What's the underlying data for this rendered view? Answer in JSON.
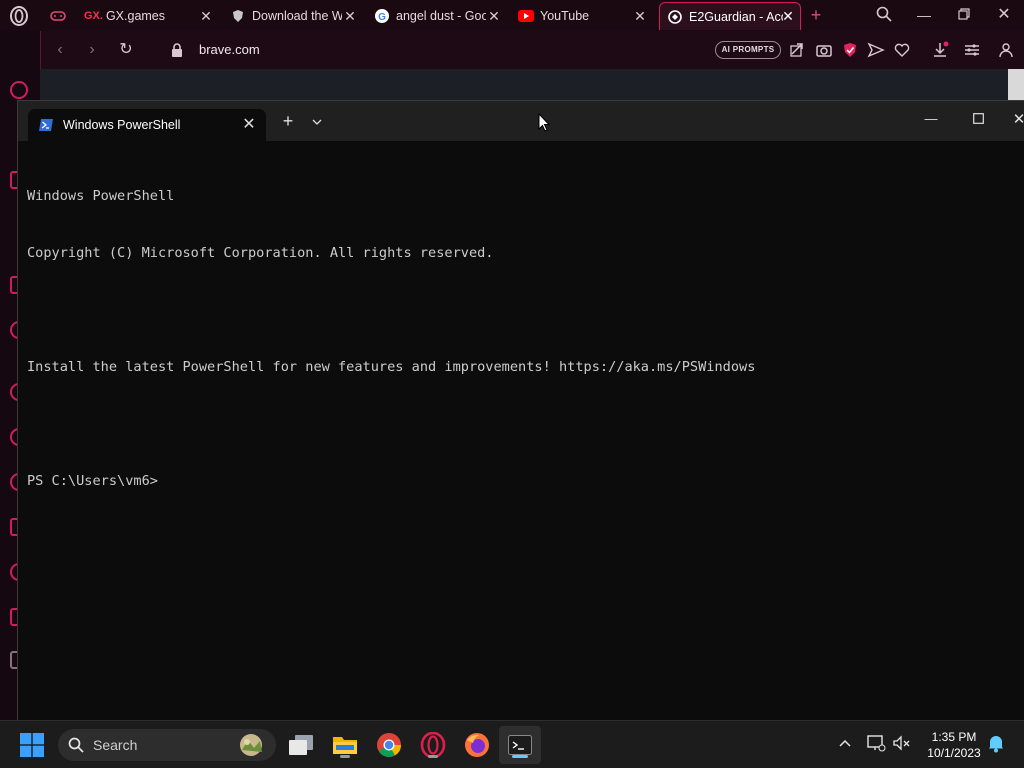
{
  "browser": {
    "tabs": [
      {
        "label": "",
        "icon": "gamepad-icon"
      },
      {
        "label": "GX.games",
        "badge": "GX.",
        "icon": "gx-icon"
      },
      {
        "label": "Download the W",
        "icon": "shield-icon"
      },
      {
        "label": "angel dust - Goo",
        "icon": "google-icon"
      },
      {
        "label": "YouTube",
        "icon": "youtube-icon"
      },
      {
        "label": "E2Guardian - Acc",
        "icon": "e2guardian-icon",
        "active": true
      }
    ],
    "new_tab_label": "+",
    "address_url": "brave.com",
    "ai_prompts_label": "AI PROMPTS",
    "accent_color": "#d11d5a"
  },
  "terminal": {
    "tab_title": "Windows PowerShell",
    "new_tab_label": "+",
    "dropdown_label": "⌄",
    "lines": [
      "Windows PowerShell",
      "Copyright (C) Microsoft Corporation. All rights reserved.",
      "",
      "Install the latest PowerShell for new features and improvements! https://aka.ms/PSWindows",
      "",
      "PS C:\\Users\\vm6>"
    ]
  },
  "taskbar": {
    "search_label": "Search",
    "apps": [
      "task-view",
      "file-explorer",
      "chrome",
      "opera",
      "firefox",
      "terminal"
    ],
    "time": "1:35 PM",
    "date": "10/1/2023"
  }
}
